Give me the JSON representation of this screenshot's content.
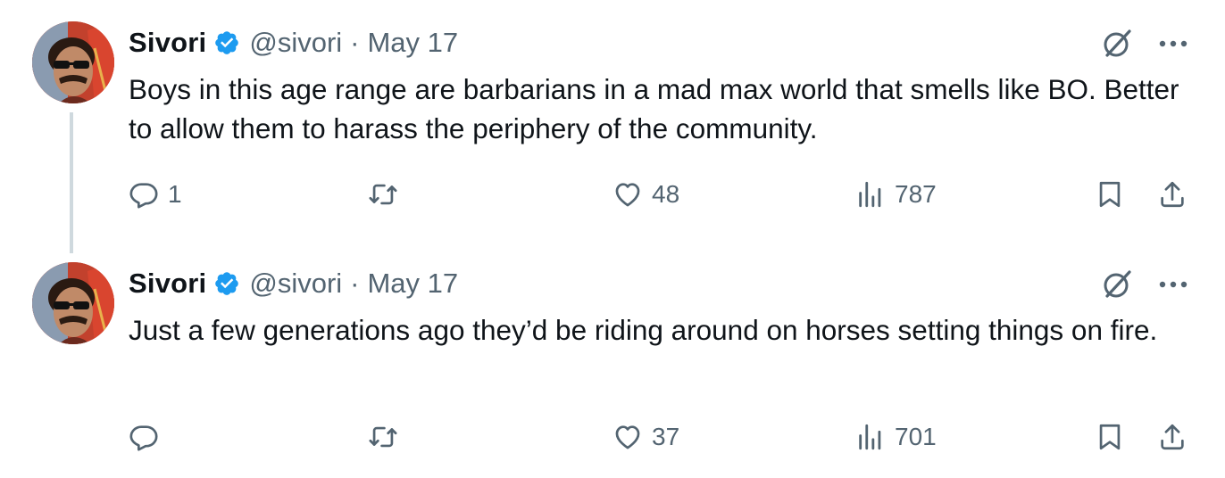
{
  "tweets": [
    {
      "author_name": "Sivori",
      "handle": "@sivori",
      "separator": "·",
      "date": "May 17",
      "text": "Boys in this age range are barbarians in a mad max world that smells like BO. Better to allow them to harass the periphery of the community.",
      "reply_count": "1",
      "retweet_count": "",
      "like_count": "48",
      "view_count": "787"
    },
    {
      "author_name": "Sivori",
      "handle": "@sivori",
      "separator": "·",
      "date": "May 17",
      "text": "Just a few generations ago they’d be riding around on horses setting things on fire.",
      "reply_count": "",
      "retweet_count": "",
      "like_count": "37",
      "view_count": "701"
    }
  ],
  "colors": {
    "verified_badge": "#1d9bf0",
    "muted_text": "#536471",
    "primary_text": "#0f1419",
    "thread_line": "#cfd9de"
  },
  "icons": [
    "verified-badge-icon",
    "grok-icon",
    "more-icon",
    "reply-icon",
    "retweet-icon",
    "like-icon",
    "views-icon",
    "bookmark-icon",
    "share-icon"
  ]
}
